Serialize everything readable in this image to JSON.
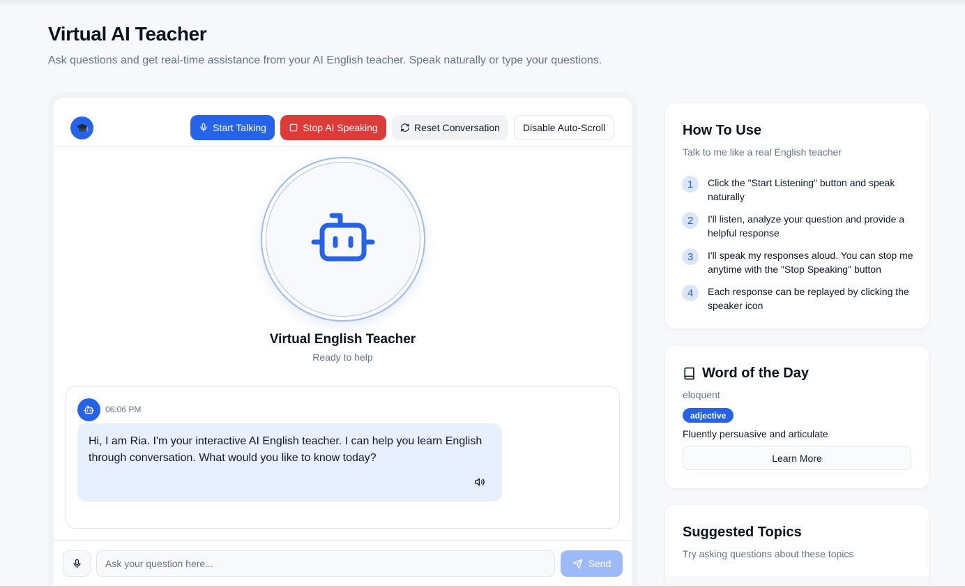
{
  "page": {
    "title": "Virtual AI Teacher",
    "subtitle": "Ask questions and get real-time assistance from your AI English teacher. Speak naturally or type your questions."
  },
  "toolbar": {
    "start_label": "Start Talking",
    "stop_label": "Stop AI Speaking",
    "reset_label": "Reset Conversation",
    "autoscroll_label": "Disable Auto-Scroll"
  },
  "teacher": {
    "name": "Virtual English Teacher",
    "status": "Ready to help"
  },
  "messages": [
    {
      "time": "06:06 PM",
      "text": "Hi, I am Ria. I'm your interactive AI English teacher. I can help you learn English through conversation. What would you like to know today?"
    }
  ],
  "input": {
    "placeholder": "Ask your question here...",
    "send_label": "Send"
  },
  "how_to_use": {
    "title": "How To Use",
    "subtitle": "Talk to me like a real English teacher",
    "steps": [
      {
        "num": "1",
        "text": "Click the \"Start Listening\" button and speak naturally"
      },
      {
        "num": "2",
        "text": "I'll listen, analyze your question and provide a helpful response"
      },
      {
        "num": "3",
        "text": "I'll speak my responses aloud. You can stop me anytime with the \"Stop Speaking\" button"
      },
      {
        "num": "4",
        "text": "Each response can be replayed by clicking the speaker icon"
      }
    ]
  },
  "word_of_the_day": {
    "title": "Word of the Day",
    "word": "eloquent",
    "part_of_speech": "adjective",
    "definition": "Fluently persuasive and articulate",
    "learn_more_label": "Learn More"
  },
  "suggested_topics": {
    "title": "Suggested Topics",
    "subtitle": "Try asking questions about these topics"
  },
  "colors": {
    "accent": "#2563eb",
    "danger": "#dc3b37",
    "bubble": "#e8efff",
    "send_disabled": "#9dbaf8"
  },
  "icons": {
    "header_avatar": "graduation-cap-icon",
    "teacher": "bot-icon",
    "start": "mic-icon",
    "stop": "square-icon",
    "reset": "refresh-icon",
    "speaker": "volume-icon",
    "send": "send-icon",
    "word": "book-icon"
  }
}
